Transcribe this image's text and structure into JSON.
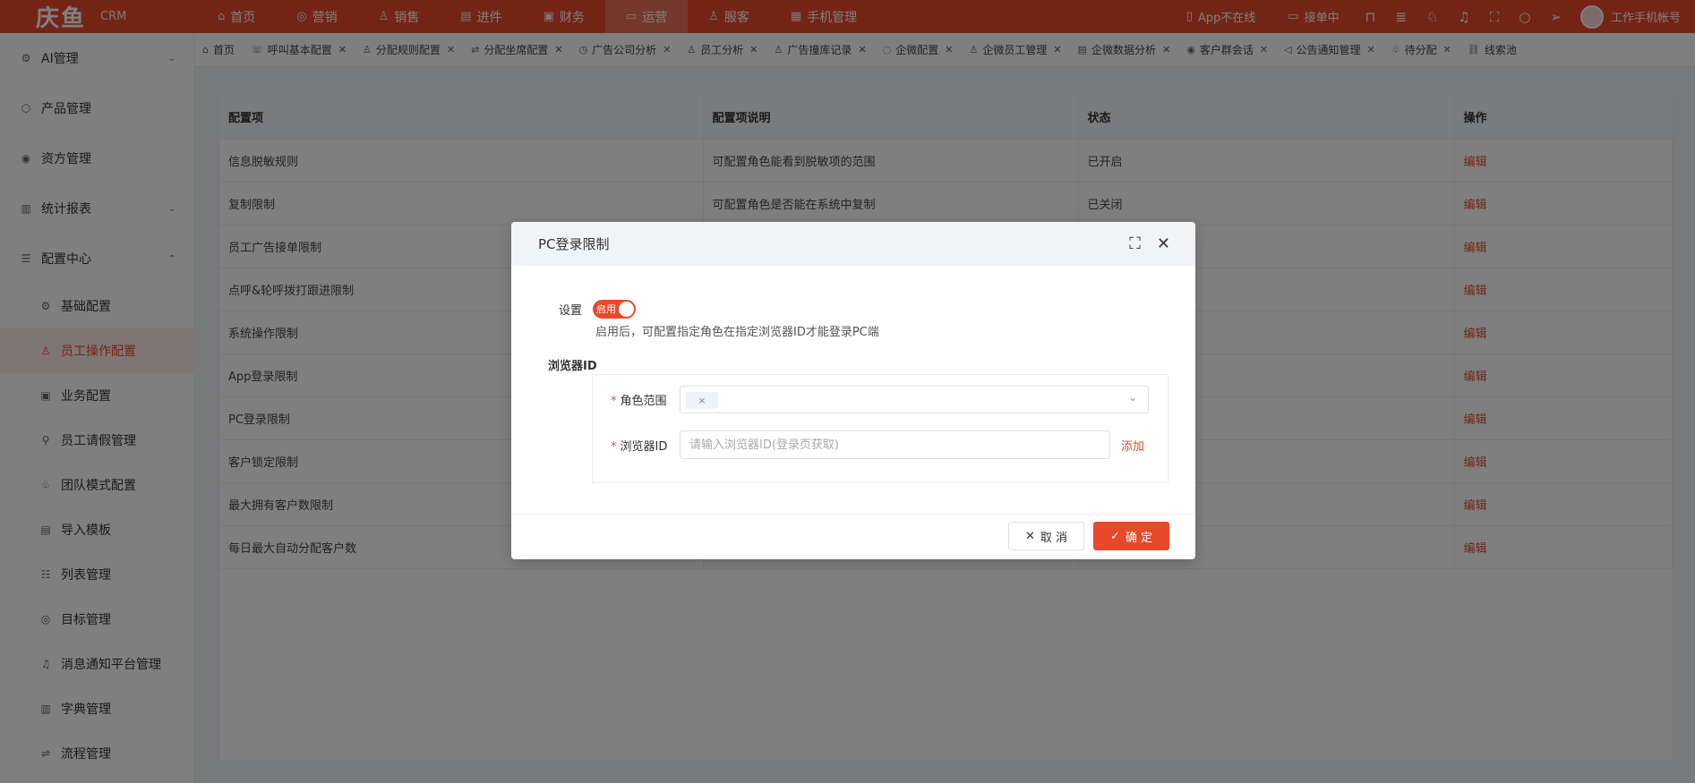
{
  "brand": {
    "name": "庆鱼",
    "sub": "CRM"
  },
  "topnav": [
    {
      "label": "首页",
      "icon": "⌂",
      "active": false
    },
    {
      "label": "营销",
      "icon": "◎",
      "active": false
    },
    {
      "label": "销售",
      "icon": "♙",
      "active": false
    },
    {
      "label": "进件",
      "icon": "▤",
      "active": false
    },
    {
      "label": "财务",
      "icon": "▣",
      "active": false
    },
    {
      "label": "运营",
      "icon": "▭",
      "active": true
    },
    {
      "label": "服客",
      "icon": "♙",
      "active": false
    },
    {
      "label": "手机管理",
      "icon": "▦",
      "active": false
    }
  ],
  "topright": {
    "app_status": "App不在线",
    "order_status": "接单中",
    "user": "工作手机帐号"
  },
  "sidebar": {
    "groups": [
      {
        "label": "AI管理",
        "icon": "⚙",
        "caret": "⌄"
      },
      {
        "label": "产品管理",
        "icon": "⬡",
        "caret": ""
      },
      {
        "label": "资方管理",
        "icon": "◉",
        "caret": ""
      },
      {
        "label": "统计报表",
        "icon": "▥",
        "caret": "⌄"
      },
      {
        "label": "配置中心",
        "icon": "☰",
        "caret": "⌃"
      }
    ],
    "subitems": [
      {
        "label": "基础配置",
        "icon": "⚙",
        "active": false
      },
      {
        "label": "员工操作配置",
        "icon": "♙",
        "active": true
      },
      {
        "label": "业务配置",
        "icon": "▣",
        "active": false
      },
      {
        "label": "员工请假管理",
        "icon": "⚲",
        "active": false
      },
      {
        "label": "团队模式配置",
        "icon": "♧",
        "active": false
      },
      {
        "label": "导入模板",
        "icon": "▤",
        "active": false
      },
      {
        "label": "列表管理",
        "icon": "☷",
        "active": false
      },
      {
        "label": "目标管理",
        "icon": "◎",
        "active": false
      },
      {
        "label": "消息通知平台管理",
        "icon": "♫",
        "active": false
      },
      {
        "label": "字典管理",
        "icon": "▥",
        "active": false
      },
      {
        "label": "流程管理",
        "icon": "⇌",
        "active": false
      }
    ]
  },
  "tabs": [
    {
      "label": "首页",
      "icon": "⌂",
      "closable": false
    },
    {
      "label": "呼叫基本配置",
      "icon": "☏",
      "closable": true
    },
    {
      "label": "分配规则配置",
      "icon": "♙",
      "closable": true
    },
    {
      "label": "分配坐席配置",
      "icon": "⇄",
      "closable": true
    },
    {
      "label": "广告公司分析",
      "icon": "◷",
      "closable": true
    },
    {
      "label": "员工分析",
      "icon": "♙",
      "closable": true
    },
    {
      "label": "广告撞库记录",
      "icon": "♙",
      "closable": true
    },
    {
      "label": "企微配置",
      "icon": "◌",
      "closable": true
    },
    {
      "label": "企微员工管理",
      "icon": "♙",
      "closable": true
    },
    {
      "label": "企微数据分析",
      "icon": "▤",
      "closable": true
    },
    {
      "label": "客户群会话",
      "icon": "◉",
      "closable": true
    },
    {
      "label": "公告通知管理",
      "icon": "◁",
      "closable": true
    },
    {
      "label": "待分配",
      "icon": "♧",
      "closable": true
    },
    {
      "label": "线索池",
      "icon": "⛓",
      "closable": false
    }
  ],
  "table": {
    "headers": [
      "配置项",
      "配置项说明",
      "状态",
      "操作"
    ],
    "rows": [
      {
        "name": "信息脱敏规则",
        "desc": "可配置角色能看到脱敏项的范围",
        "status": "已开启",
        "op": "编辑"
      },
      {
        "name": "复制限制",
        "desc": "可配置角色是否能在系统中复制",
        "status": "已关闭",
        "op": "编辑"
      },
      {
        "name": "员工广告接单限制",
        "desc": "",
        "status": "",
        "op": "编辑"
      },
      {
        "name": "点呼&轮呼拨打跟进限制",
        "desc": "",
        "status": "",
        "op": "编辑"
      },
      {
        "name": "系统操作限制",
        "desc": "",
        "status": "",
        "op": "编辑"
      },
      {
        "name": "App登录限制",
        "desc": "",
        "status": "",
        "op": "编辑"
      },
      {
        "name": "PC登录限制",
        "desc": "",
        "status": "",
        "op": "编辑"
      },
      {
        "name": "客户锁定限制",
        "desc": "",
        "status": "",
        "op": "编辑"
      },
      {
        "name": "最大拥有客户数限制",
        "desc": "",
        "status": "",
        "op": "编辑"
      },
      {
        "name": "每日最大自动分配客户数",
        "desc": "",
        "status": "",
        "op": "编辑"
      }
    ]
  },
  "modal": {
    "title": "PC登录限制",
    "setting_label": "设置",
    "switch_text": "启用",
    "hint": "启用后，可配置指定角色在指定浏览器ID才能登录PC端",
    "section_label": "浏览器ID",
    "role_label": "角色范围",
    "tag_close": "×",
    "browser_label": "浏览器ID",
    "browser_value": "",
    "browser_placeholder": "请输入浏览器ID(登录页获取)",
    "add_label": "添加",
    "cancel_label": "取 消",
    "ok_label": "确 定"
  }
}
